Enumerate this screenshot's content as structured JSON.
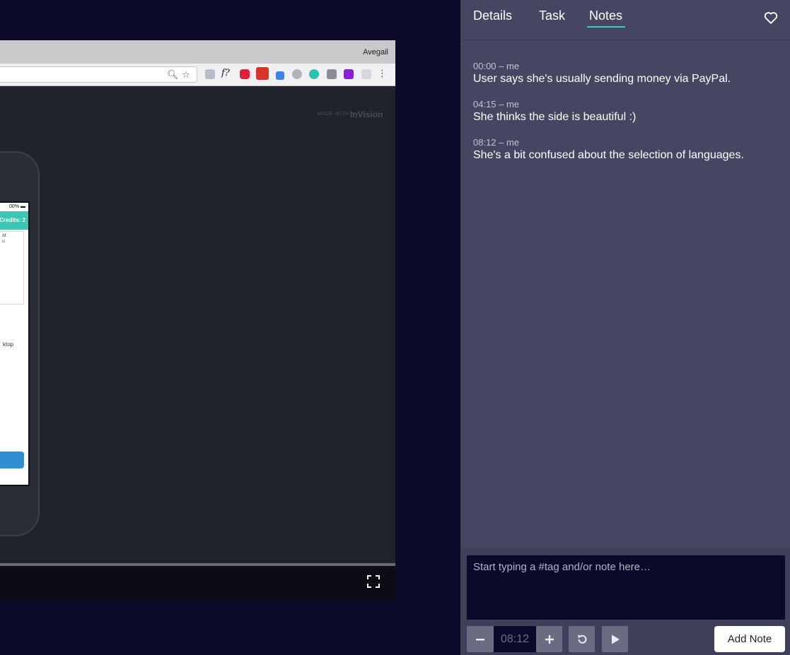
{
  "video": {
    "browser_user": "Avegail",
    "made_with_label": "MADE WITH",
    "invision_logo": "InVision",
    "phone_status": "00% ▬",
    "phone_header": "Credits: 2",
    "phone_card_text_1": "at",
    "phone_card_text_2": "u",
    "phone_footer_text": "ktop",
    "toolbar_icons": [
      "search-icon",
      "star-icon",
      "extension-icons",
      "kebab-menu-icon"
    ],
    "fullscreen_icon": "fullscreen-icon"
  },
  "panel": {
    "tabs": [
      {
        "label": "Details"
      },
      {
        "label": "Task"
      },
      {
        "label": "Notes",
        "active": true
      }
    ],
    "favorite_icon": "heart-icon",
    "accent_color": "#3ad1b8",
    "notes": [
      {
        "meta": "00:00 – me",
        "text": "User says she's usually sending money via PayPal."
      },
      {
        "meta": "04:15 – me",
        "text": "She thinks the side is beautiful :)"
      },
      {
        "meta": "08:12 – me",
        "text": "She's a bit confused about the selection of languages."
      }
    ],
    "composer": {
      "placeholder": "Start typing a #tag and/or note here…",
      "time": "08:12",
      "add_label": "Add Note"
    }
  }
}
